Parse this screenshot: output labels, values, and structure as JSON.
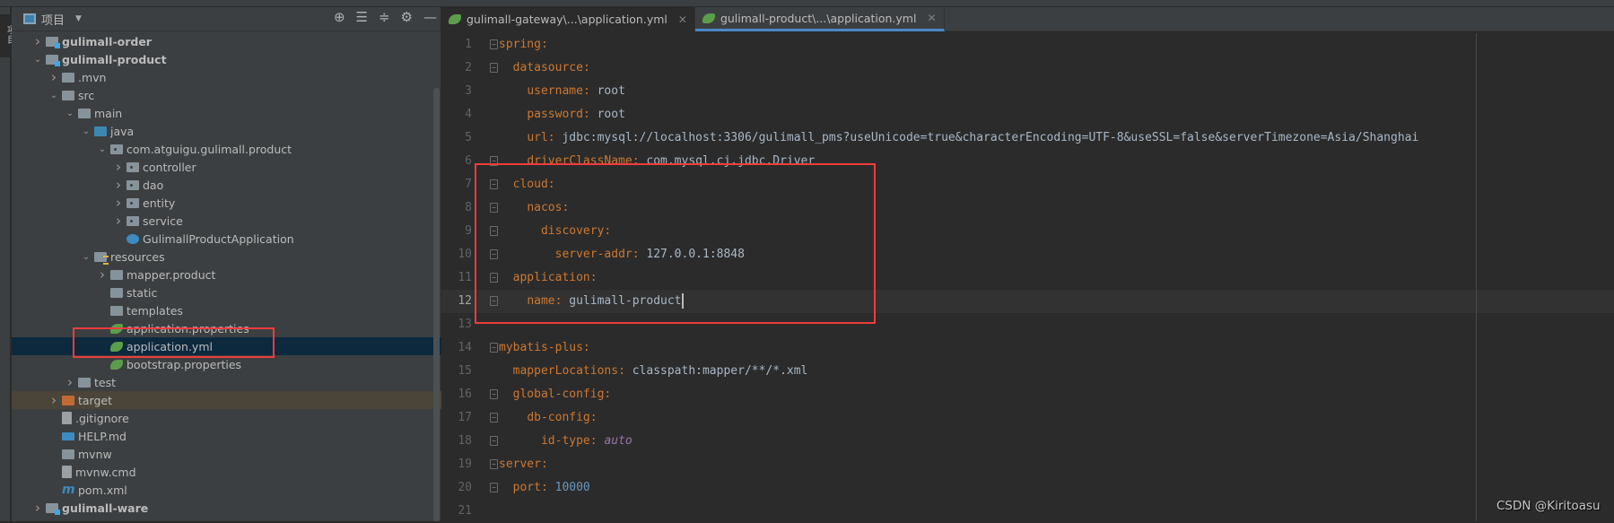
{
  "sidebar": {
    "title": "项目",
    "side_tab": "项目",
    "tools": [
      "locate-icon",
      "expand-all-icon",
      "collapse-all-icon",
      "gear-icon",
      "minimize-icon"
    ],
    "tree": [
      {
        "label": "gulimall-order",
        "level": 0,
        "chevron": "right",
        "icon": "module",
        "bold": true
      },
      {
        "label": "gulimall-product",
        "level": 0,
        "chevron": "down",
        "icon": "module",
        "bold": true
      },
      {
        "label": ".mvn",
        "level": 1,
        "chevron": "right",
        "icon": "folder"
      },
      {
        "label": "src",
        "level": 1,
        "chevron": "down",
        "icon": "folder"
      },
      {
        "label": "main",
        "level": 2,
        "chevron": "down",
        "icon": "folder"
      },
      {
        "label": "java",
        "level": 3,
        "chevron": "down",
        "icon": "src"
      },
      {
        "label": "com.atguigu.gulimall.product",
        "level": 4,
        "chevron": "down",
        "icon": "package"
      },
      {
        "label": "controller",
        "level": 5,
        "chevron": "right",
        "icon": "package"
      },
      {
        "label": "dao",
        "level": 5,
        "chevron": "right",
        "icon": "package"
      },
      {
        "label": "entity",
        "level": 5,
        "chevron": "right",
        "icon": "package"
      },
      {
        "label": "service",
        "level": 5,
        "chevron": "right",
        "icon": "package"
      },
      {
        "label": "GulimallProductApplication",
        "level": 5,
        "chevron": "",
        "icon": "spring-app"
      },
      {
        "label": "resources",
        "level": 3,
        "chevron": "down",
        "icon": "resources"
      },
      {
        "label": "mapper.product",
        "level": 4,
        "chevron": "right",
        "icon": "folder"
      },
      {
        "label": "static",
        "level": 4,
        "chevron": "",
        "icon": "folder"
      },
      {
        "label": "templates",
        "level": 4,
        "chevron": "",
        "icon": "folder"
      },
      {
        "label": "application.properties",
        "level": 4,
        "chevron": "",
        "icon": "spring"
      },
      {
        "label": "application.yml",
        "level": 4,
        "chevron": "",
        "icon": "spring",
        "selected": true
      },
      {
        "label": "bootstrap.properties",
        "level": 4,
        "chevron": "",
        "icon": "spring"
      },
      {
        "label": "test",
        "level": 2,
        "chevron": "right",
        "icon": "folder"
      },
      {
        "label": "target",
        "level": 1,
        "chevron": "right",
        "icon": "target",
        "excluded": true
      },
      {
        "label": ".gitignore",
        "level": 1,
        "chevron": "",
        "icon": "file"
      },
      {
        "label": "HELP.md",
        "level": 1,
        "chevron": "",
        "icon": "md"
      },
      {
        "label": "mvnw",
        "level": 1,
        "chevron": "",
        "icon": "shell"
      },
      {
        "label": "mvnw.cmd",
        "level": 1,
        "chevron": "",
        "icon": "file"
      },
      {
        "label": "pom.xml",
        "level": 1,
        "chevron": "",
        "icon": "maven"
      },
      {
        "label": "gulimall-ware",
        "level": 0,
        "chevron": "right",
        "icon": "module",
        "bold": true
      }
    ]
  },
  "editor": {
    "tabs": [
      {
        "label": "gulimall-gateway\\...\\application.yml",
        "active": false
      },
      {
        "label": "gulimall-product\\...\\application.yml",
        "active": true
      }
    ],
    "current_line": 12,
    "lines": [
      [
        [
          "k",
          "spring"
        ],
        [
          "p",
          ":"
        ]
      ],
      [
        [
          "v",
          "  "
        ],
        [
          "k",
          "datasource"
        ],
        [
          "p",
          ":"
        ]
      ],
      [
        [
          "v",
          "    "
        ],
        [
          "k",
          "username"
        ],
        [
          "p",
          ": "
        ],
        [
          "v",
          "root"
        ]
      ],
      [
        [
          "v",
          "    "
        ],
        [
          "k",
          "password"
        ],
        [
          "p",
          ": "
        ],
        [
          "v",
          "root"
        ]
      ],
      [
        [
          "v",
          "    "
        ],
        [
          "k",
          "url"
        ],
        [
          "p",
          ": "
        ],
        [
          "v",
          "jdbc:mysql://localhost:3306/gulimall_pms?useUnicode=true&characterEncoding=UTF-8&useSSL=false&serverTimezone=Asia/Shanghai"
        ]
      ],
      [
        [
          "v",
          "    "
        ],
        [
          "k",
          "driverClassName"
        ],
        [
          "p",
          ": "
        ],
        [
          "v",
          "com.mysql.cj.jdbc.Driver"
        ]
      ],
      [
        [
          "v",
          "  "
        ],
        [
          "k",
          "cloud"
        ],
        [
          "p",
          ":"
        ]
      ],
      [
        [
          "v",
          "    "
        ],
        [
          "k",
          "nacos"
        ],
        [
          "p",
          ":"
        ]
      ],
      [
        [
          "v",
          "      "
        ],
        [
          "k",
          "discovery"
        ],
        [
          "p",
          ":"
        ]
      ],
      [
        [
          "v",
          "        "
        ],
        [
          "k",
          "server-addr"
        ],
        [
          "p",
          ": "
        ],
        [
          "v",
          "127.0.0.1:8848"
        ]
      ],
      [
        [
          "v",
          "  "
        ],
        [
          "k",
          "application"
        ],
        [
          "p",
          ":"
        ]
      ],
      [
        [
          "v",
          "    "
        ],
        [
          "k",
          "name"
        ],
        [
          "p",
          ": "
        ],
        [
          "v",
          "gulimall-product"
        ]
      ],
      [],
      [
        [
          "k",
          "mybatis-plus"
        ],
        [
          "p",
          ":"
        ]
      ],
      [
        [
          "v",
          "  "
        ],
        [
          "k",
          "mapperLocations"
        ],
        [
          "p",
          ": "
        ],
        [
          "v",
          "classpath:mapper/**/*.xml"
        ]
      ],
      [
        [
          "v",
          "  "
        ],
        [
          "k",
          "global-config"
        ],
        [
          "p",
          ":"
        ]
      ],
      [
        [
          "v",
          "    "
        ],
        [
          "k",
          "db-config"
        ],
        [
          "p",
          ":"
        ]
      ],
      [
        [
          "v",
          "      "
        ],
        [
          "k",
          "id-type"
        ],
        [
          "p",
          ": "
        ],
        [
          "c",
          "auto"
        ]
      ],
      [
        [
          "k",
          "server"
        ],
        [
          "p",
          ":"
        ]
      ],
      [
        [
          "v",
          "  "
        ],
        [
          "k",
          "port"
        ],
        [
          "p",
          ": "
        ],
        [
          "n",
          "10000"
        ]
      ],
      []
    ],
    "folds": [
      1,
      2,
      6,
      7,
      8,
      9,
      10,
      11,
      12,
      14,
      16,
      17,
      18,
      19,
      20
    ]
  },
  "annotation_color": "#f03c3c",
  "watermark": "CSDN @Kiritoasu"
}
